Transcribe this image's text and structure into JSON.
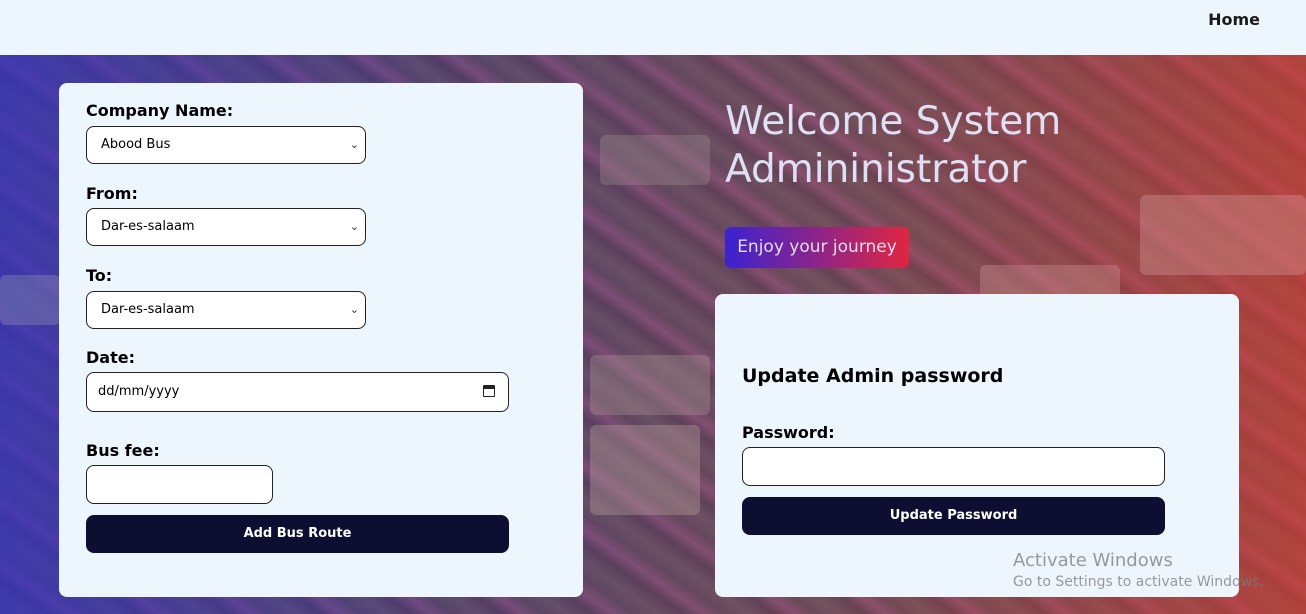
{
  "nav": {
    "home_label": "Home"
  },
  "route_form": {
    "company_label": "Company Name:",
    "company_value": "Abood Bus",
    "from_label": "From:",
    "from_value": "Dar-es-salaam",
    "to_label": "To:",
    "to_value": "Dar-es-salaam",
    "date_label": "Date:",
    "date_placeholder": "dd/mm/yyyy",
    "fee_label": "Bus fee:",
    "fee_value": "",
    "submit_label": "Add Bus Route"
  },
  "hero": {
    "welcome_line1": "Welcome System",
    "welcome_line2": "Admininistrator",
    "tagline": "Enjoy your journey"
  },
  "password_form": {
    "title": "Update Admin password",
    "password_label": "Password:",
    "password_value": "",
    "submit_label": "Update Password"
  },
  "watermark": {
    "line1": "Activate Windows",
    "line2": "Go to Settings to activate Windows."
  },
  "icons": {
    "select_chevron": "chevron-down-icon",
    "date_picker": "calendar-icon"
  },
  "colors": {
    "page_bg": "#eef6fd",
    "button_bg": "#0e0e33",
    "button_text": "#ffffff",
    "tag_gradient_start": "#3a23d0",
    "tag_gradient_end": "#e02640"
  }
}
